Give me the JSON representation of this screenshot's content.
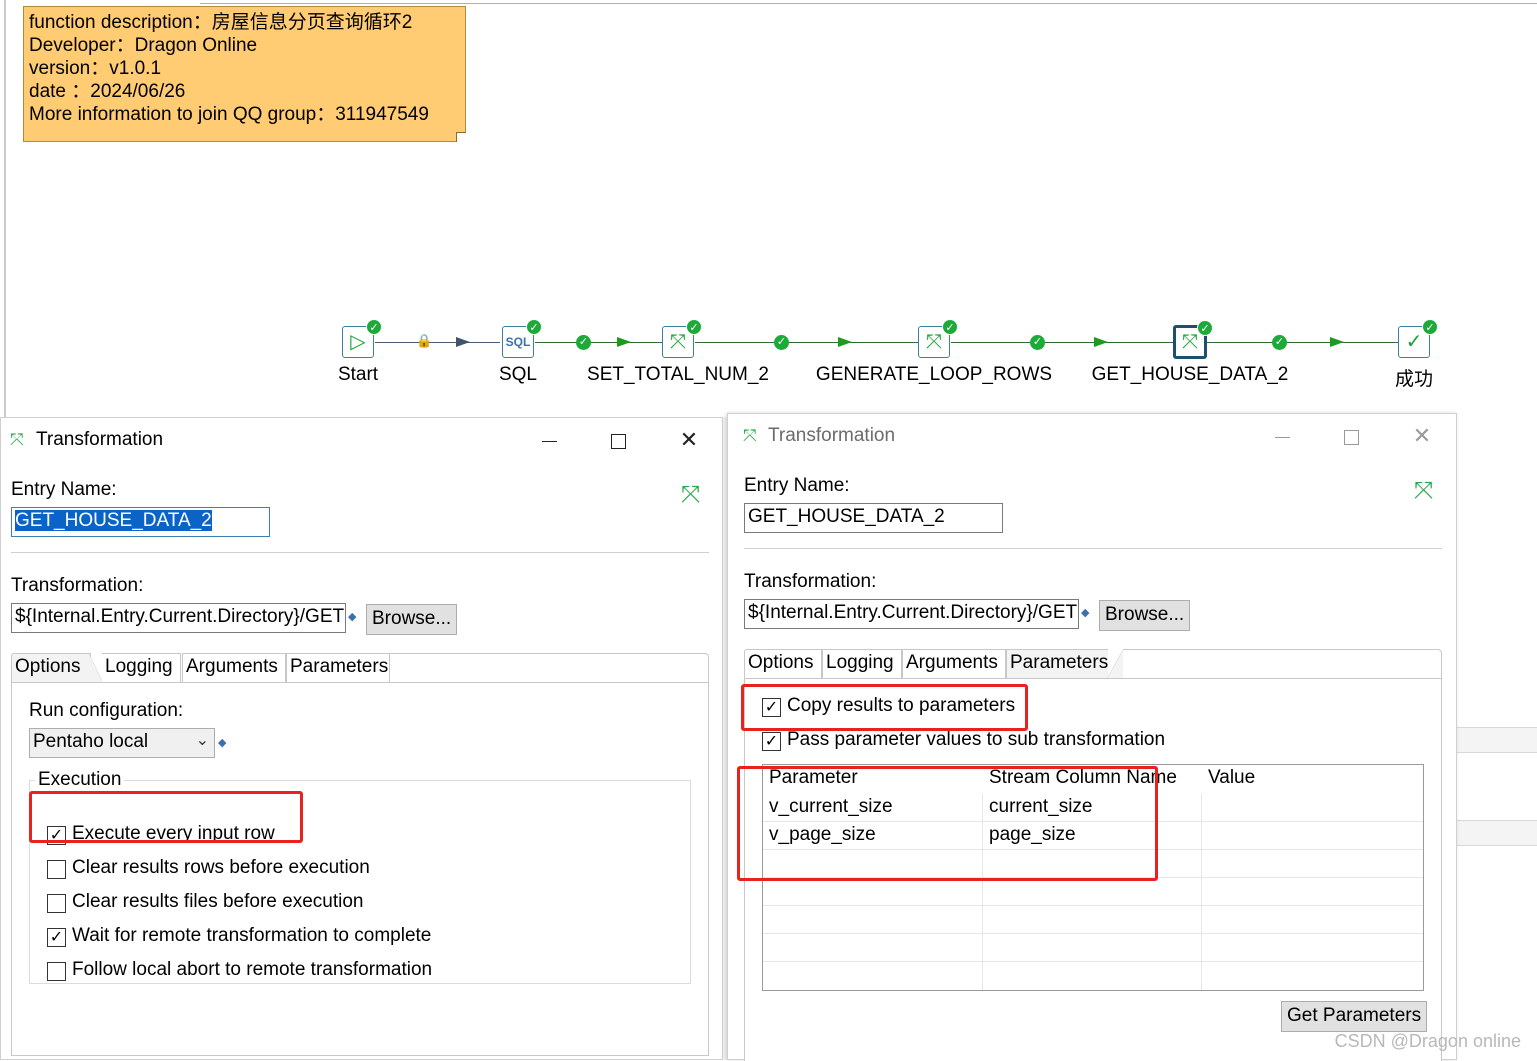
{
  "note": {
    "lines": [
      "function description：房屋信息分页查询循环2",
      "Developer：Dragon Online",
      "version：v1.0.1",
      "date ：2024/06/26",
      "More information to join QQ group：311947549"
    ]
  },
  "flow": {
    "nodes": [
      {
        "label": "Start",
        "icon": "play-icon"
      },
      {
        "label": "SQL",
        "icon": "sql-script-icon"
      },
      {
        "label": "SET_TOTAL_NUM_2",
        "icon": "transformation-icon"
      },
      {
        "label": "GENERATE_LOOP_ROWS",
        "icon": "transformation-icon"
      },
      {
        "label": "GET_HOUSE_DATA_2",
        "icon": "transformation-icon"
      },
      {
        "label": "成功",
        "icon": "success-check-icon"
      }
    ]
  },
  "left_dialog": {
    "title": "Transformation",
    "entry_name_label": "Entry Name:",
    "entry_name_value": "GET_HOUSE_DATA_2",
    "transformation_label": "Transformation:",
    "transformation_value": "${Internal.Entry.Current.Directory}/GET",
    "browse_label": "Browse...",
    "tabs": [
      "Options",
      "Logging",
      "Arguments",
      "Parameters"
    ],
    "active_tab": "Options",
    "run_config_label": "Run configuration:",
    "run_config_value": "Pentaho local",
    "execution_group": "Execution",
    "checkboxes": [
      {
        "label": "Execute every input row",
        "checked": true
      },
      {
        "label": "Clear results rows before execution",
        "checked": false
      },
      {
        "label": "Clear results files before execution",
        "checked": false
      },
      {
        "label": "Wait for remote transformation to complete",
        "checked": true
      },
      {
        "label": "Follow local abort to remote transformation",
        "checked": false
      }
    ]
  },
  "right_dialog": {
    "title": "Transformation",
    "entry_name_label": "Entry Name:",
    "entry_name_value": "GET_HOUSE_DATA_2",
    "transformation_label": "Transformation:",
    "transformation_value": "${Internal.Entry.Current.Directory}/GET",
    "browse_label": "Browse...",
    "tabs": [
      "Options",
      "Logging",
      "Arguments",
      "Parameters"
    ],
    "active_tab": "Parameters",
    "checkboxes": [
      {
        "label": "Copy results to parameters",
        "checked": true
      },
      {
        "label": "Pass parameter values to sub transformation",
        "checked": true
      }
    ],
    "grid": {
      "columns": [
        "Parameter",
        "Stream Column Name",
        "Value"
      ],
      "rows": [
        [
          "v_current_size",
          "current_size",
          ""
        ],
        [
          "v_page_size",
          "page_size",
          ""
        ]
      ]
    },
    "get_params_label": "Get Parameters"
  },
  "watermark": "CSDN @Dragon online",
  "colors": {
    "note_bg": "#ffcc73",
    "success_green": "#1eaa3a",
    "highlight_red": "#e8231f",
    "selection_blue": "#0a64c8"
  }
}
